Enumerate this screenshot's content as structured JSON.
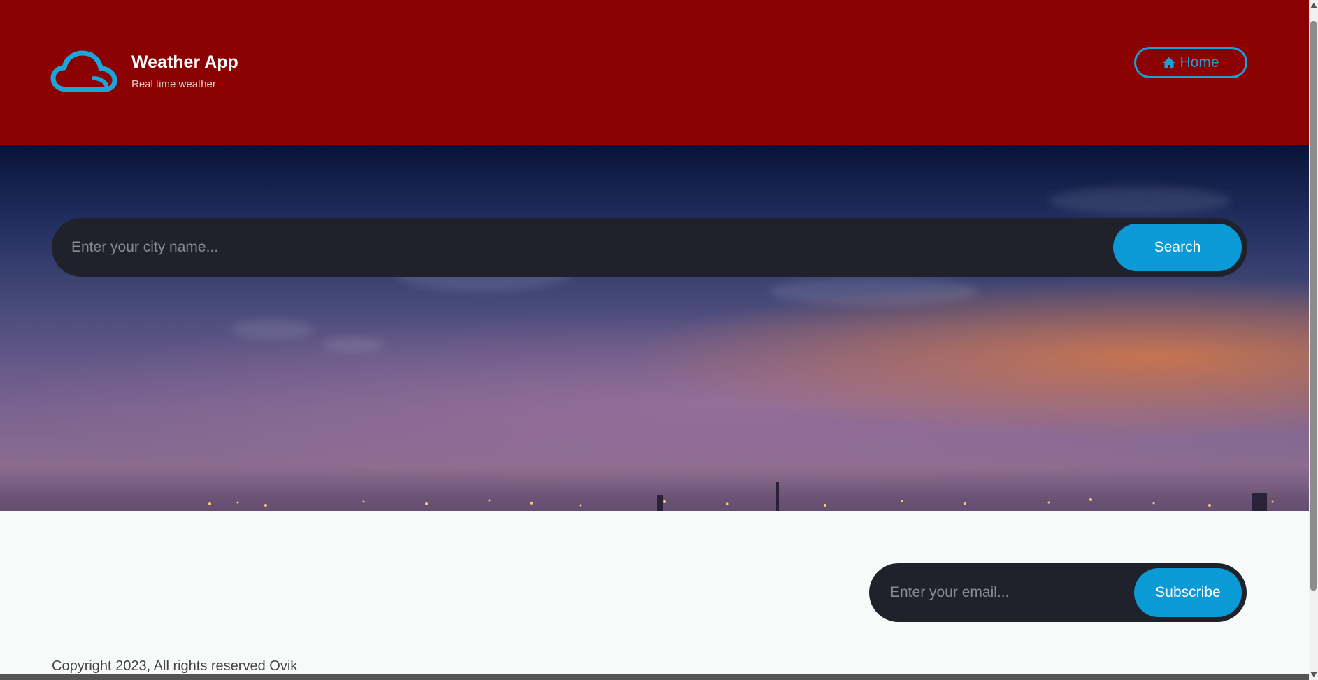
{
  "header": {
    "logo_icon": "cloud-icon",
    "title": "Weather App",
    "tagline": "Real time weather",
    "home_label": "Home",
    "home_icon": "home-icon",
    "bg_color": "#8b0000",
    "accent_color": "#1a9fd6"
  },
  "search": {
    "placeholder": "Enter your city name...",
    "value": "",
    "button_label": "Search"
  },
  "footer": {
    "email_placeholder": "Enter your email...",
    "email_value": "",
    "subscribe_label": "Subscribe",
    "copyright": "Copyright 2023, All rights reserved Ovik"
  },
  "colors": {
    "button": "#0a9ad6",
    "input_bg": "#20222b"
  }
}
